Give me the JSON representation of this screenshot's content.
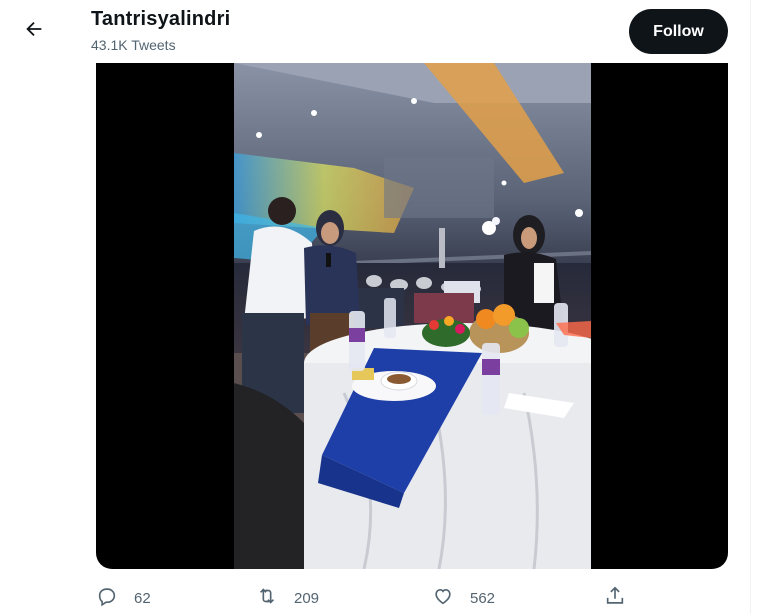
{
  "header": {
    "back_icon": "arrow-left-icon",
    "title": "Tantrisyalindri",
    "subtitle": "43.1K Tweets",
    "follow_label": "Follow"
  },
  "media": {
    "type": "video"
  },
  "actions": {
    "reply": {
      "icon": "reply-icon",
      "count": "62"
    },
    "retweet": {
      "icon": "retweet-icon",
      "count": "209"
    },
    "like": {
      "icon": "heart-icon",
      "count": "562"
    },
    "share": {
      "icon": "share-icon"
    }
  },
  "colors": {
    "follow_bg": "#0f1419",
    "secondary_text": "#536471",
    "tablecloth_blue": "#1e3fa8"
  }
}
